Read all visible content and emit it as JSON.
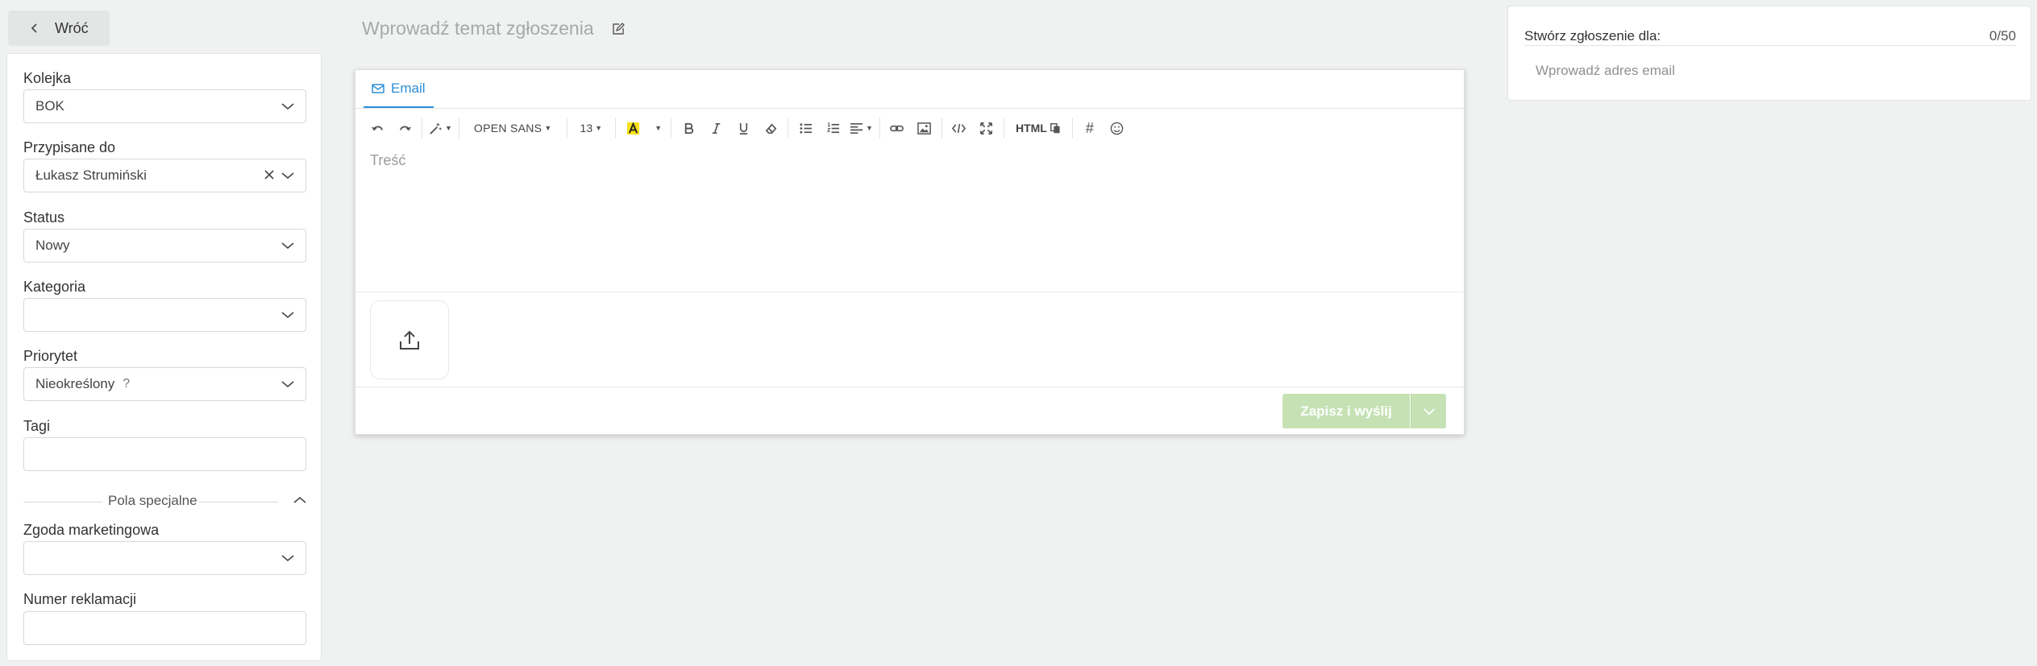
{
  "back": {
    "label": "Wróć"
  },
  "sidebar": {
    "queue": {
      "label": "Kolejka",
      "value": "BOK"
    },
    "assigned": {
      "label": "Przypisane do",
      "value": "Łukasz Strumiński"
    },
    "status": {
      "label": "Status",
      "value": "Nowy"
    },
    "category": {
      "label": "Kategoria",
      "value": ""
    },
    "priority": {
      "label": "Priorytet",
      "value": "Nieokreślony",
      "help": "?"
    },
    "tags": {
      "label": "Tagi",
      "value": ""
    },
    "special_section": {
      "label": "Pola specjalne"
    },
    "marketing_consent": {
      "label": "Zgoda marketingowa",
      "value": ""
    },
    "complaint_number": {
      "label": "Numer reklamacji",
      "value": ""
    }
  },
  "subject": {
    "placeholder": "Wprowadź temat zgłoszenia"
  },
  "editor": {
    "tab_label": "Email",
    "font_family": "OPEN SANS",
    "font_size": "13",
    "html_label": "HTML",
    "hash_label": "#",
    "body_placeholder": "Treść",
    "send_label": "Zapisz i wyślij",
    "send_color": "#c6e2b5",
    "accent_color": "#2d8fd5",
    "icons": [
      "undo-icon",
      "redo-icon",
      "magic-wand-icon",
      "text-color-icon",
      "bold-icon",
      "italic-icon",
      "underline-icon",
      "eraser-icon",
      "bullet-list-icon",
      "numbered-list-icon",
      "align-icon",
      "link-icon",
      "image-icon",
      "code-icon",
      "fullscreen-icon",
      "copy-icon",
      "emoji-icon",
      "upload-icon"
    ]
  },
  "recipient": {
    "title": "Stwórz zgłoszenie dla:",
    "counter": "0/50",
    "placeholder": "Wprowadź adres email"
  }
}
